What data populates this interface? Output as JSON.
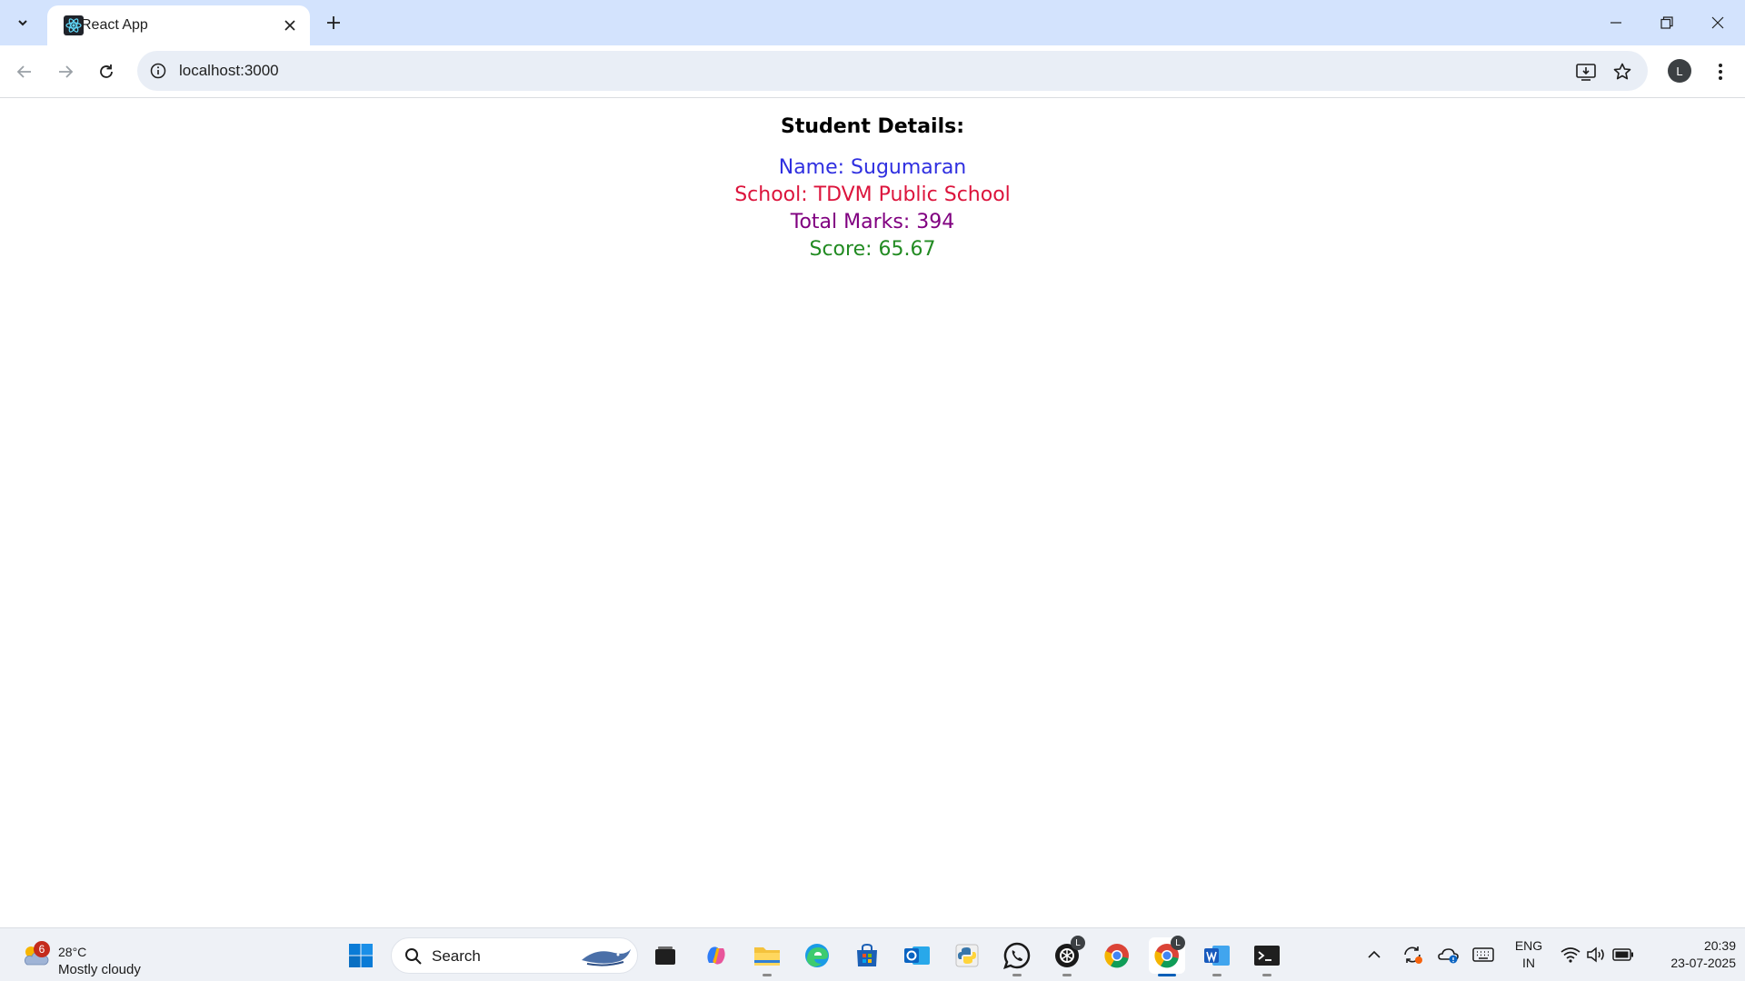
{
  "browser": {
    "tab_title": "React App",
    "url": "localhost:3000",
    "avatar_letter": "L"
  },
  "page": {
    "heading": "Student Details:",
    "details": [
      {
        "text": "Name: Sugumaran",
        "color": "#2f2fe0"
      },
      {
        "text": "School: TDVM Public School",
        "color": "#dc143c"
      },
      {
        "text": "Total Marks: 394",
        "color": "#800080"
      },
      {
        "text": "Score: 65.67",
        "color": "#228b22"
      }
    ]
  },
  "taskbar": {
    "weather": {
      "badge": "6",
      "temp": "28°C",
      "condition": "Mostly cloudy"
    },
    "search_placeholder": "Search",
    "language": {
      "line1": "ENG",
      "line2": "IN"
    },
    "clock": {
      "time": "20:39",
      "date": "23-07-2025"
    },
    "badge_letter": "L"
  }
}
